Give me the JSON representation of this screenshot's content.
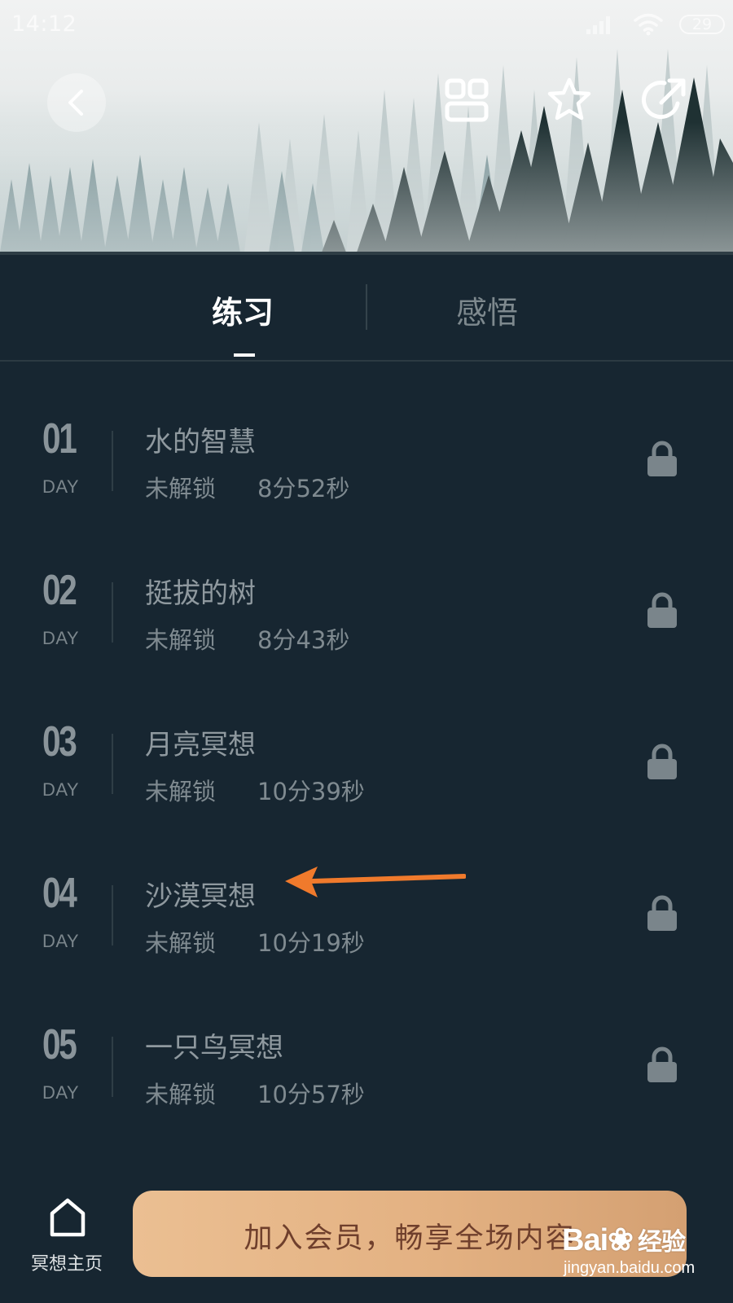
{
  "status_bar": {
    "time": "14:12",
    "battery": "29"
  },
  "header": {
    "icons": [
      "back-icon",
      "grid-icon",
      "star-icon",
      "share-icon"
    ]
  },
  "tabs": [
    {
      "label": "练习",
      "active": true
    },
    {
      "label": "感悟",
      "active": false
    }
  ],
  "lessons": [
    {
      "day": "01",
      "day_label": "DAY",
      "title": "水的智慧",
      "status": "未解锁",
      "duration": "8分52秒"
    },
    {
      "day": "02",
      "day_label": "DAY",
      "title": "挺拔的树",
      "status": "未解锁",
      "duration": "8分43秒"
    },
    {
      "day": "03",
      "day_label": "DAY",
      "title": "月亮冥想",
      "status": "未解锁",
      "duration": "10分39秒"
    },
    {
      "day": "04",
      "day_label": "DAY",
      "title": "沙漠冥想",
      "status": "未解锁",
      "duration": "10分19秒"
    },
    {
      "day": "05",
      "day_label": "DAY",
      "title": "一只鸟冥想",
      "status": "未解锁",
      "duration": "10分57秒"
    }
  ],
  "bottom": {
    "home_label": "冥想主页",
    "join_label": "加入会员，畅享全场内容"
  },
  "watermark": {
    "brand_prefix": "Bai",
    "brand_suffix": "经验",
    "url": "jingyan.baidu.com"
  },
  "colors": {
    "background": "#172631",
    "join_button": "#e3b182",
    "annotation_arrow": "#f07a2c"
  }
}
